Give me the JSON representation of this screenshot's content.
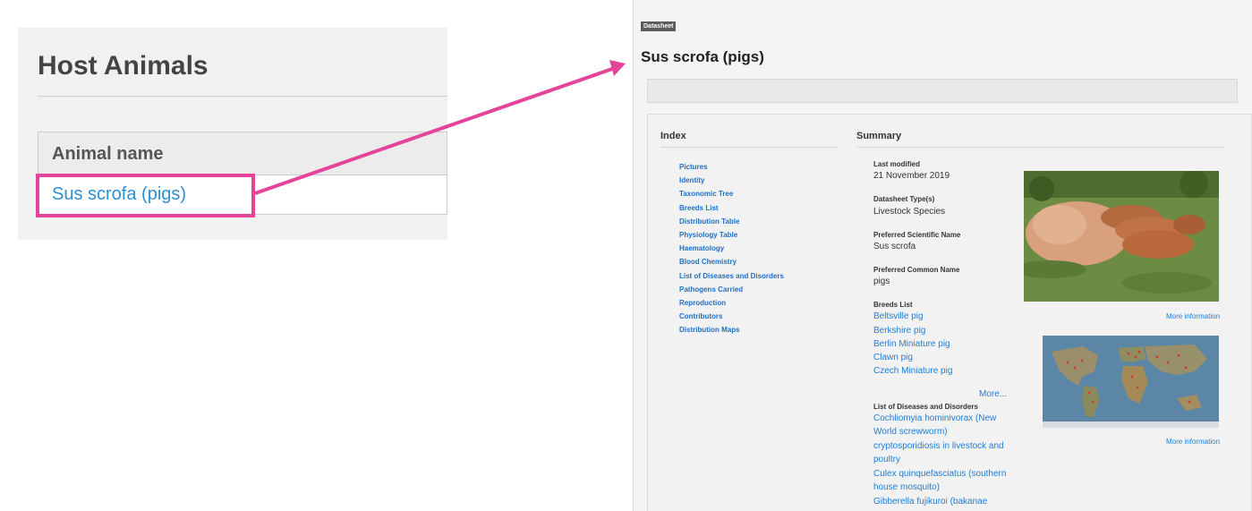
{
  "host_animals": {
    "title": "Host Animals",
    "column_header": "Animal name",
    "row_link": "Sus scrofa (pigs)"
  },
  "annotation": {
    "highlight_color": "#e4449a"
  },
  "datasheet": {
    "badge": "Datasheet",
    "title": "Sus scrofa (pigs)",
    "index": {
      "heading": "Index",
      "items": [
        "Pictures",
        "Identity",
        "Taxonomic Tree",
        "Breeds List",
        "Distribution Table",
        "Physiology Table",
        "Haematology",
        "Blood Chemistry",
        "List of Diseases and Disorders",
        "Pathogens Carried",
        "Reproduction",
        "Contributors",
        "Distribution Maps"
      ]
    },
    "summary": {
      "heading": "Summary",
      "last_modified_label": "Last modified",
      "last_modified_value": "21 November 2019",
      "type_label": "Datasheet Type(s)",
      "type_value": "Livestock Species",
      "sci_name_label": "Preferred Scientific Name",
      "sci_name_value": "Sus scrofa",
      "common_name_label": "Preferred Common Name",
      "common_name_value": "pigs",
      "breeds_label": "Breeds List",
      "breeds": [
        "Beltsville pig",
        "Berkshire pig",
        "Berlin Miniature pig",
        "Clawn pig",
        "Czech Miniature pig"
      ],
      "more_label": "More...",
      "diseases_label": "List of Diseases and Disorders",
      "diseases_lines": [
        "Cochliomyia hominivorax (New",
        "World screwworm)",
        "cryptosporidiosis in livestock and",
        "poultry",
        "Culex quinquefasciatus (southern",
        "house mosquito)",
        "Gibberella fujikuroi (bakanae"
      ],
      "more_information_1": "More information",
      "more_information_2": "More information"
    }
  }
}
